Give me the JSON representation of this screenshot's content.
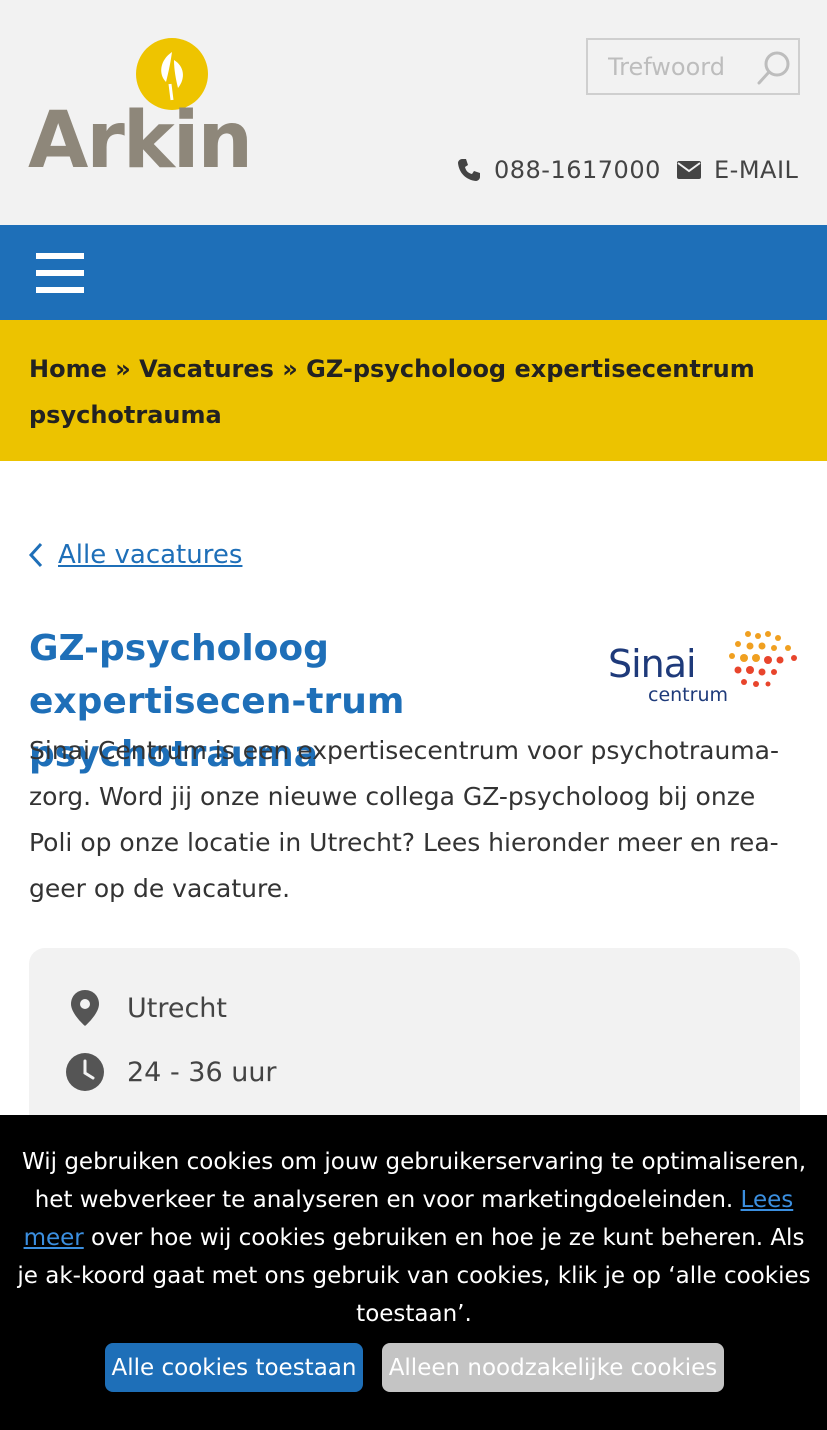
{
  "header": {
    "logo_text": "Arkin",
    "search_placeholder": "Trefwoord",
    "phone": "088-1617000",
    "email_label": "E-MAIL"
  },
  "colors": {
    "brand_blue": "#1e6fb8",
    "brand_yellow": "#ecc300",
    "logo_gray": "#8e877a"
  },
  "breadcrumb": {
    "home": "Home",
    "sep1": "»",
    "vacatures": "Vacatures",
    "sep2": "»",
    "current": "GZ-psycholoog expertisecentrum psychotrauma"
  },
  "main": {
    "back_link": "Alle vacatures",
    "title": "GZ-psycholoog expertisecen-trum psychotrauma",
    "org_logo_name": "Sinai",
    "org_logo_sub": "centrum",
    "intro": "Sinai Centrum is een expertisecentrum voor psychotrauma-zorg. Word jij onze nieuwe collega GZ-psycholoog bij onze Poli op onze locatie in Utrecht? Lees hieronder meer en rea-geer op de vacature.",
    "location": "Utrecht",
    "hours": "24 - 36 uur"
  },
  "cookie": {
    "text_before": "Wij gebruiken cookies om jouw gebruikerservaring te optimaliseren, het webverkeer te analyseren en voor marketingdoeleinden.",
    "link": "Lees meer",
    "text_after": "over hoe wij cookies gebruiken en hoe je ze kunt beheren. Als je ak-koord gaat met ons gebruik van cookies, klik je op ‘alle cookies toestaan’.",
    "accept_all": "Alle cookies toestaan",
    "necessary_only": "Alleen noodzakelijke cookies"
  }
}
